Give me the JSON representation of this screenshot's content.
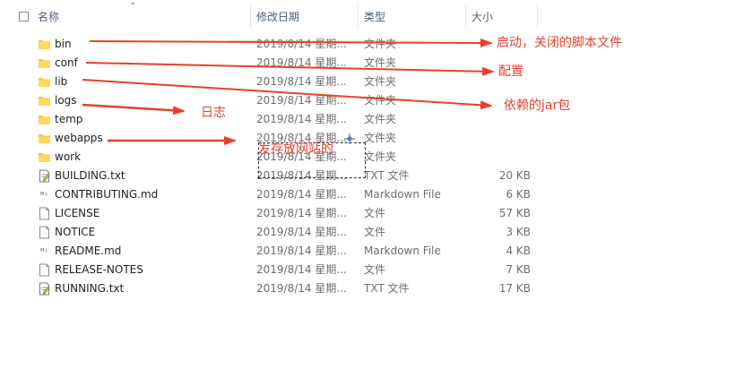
{
  "header": {
    "name": "名称",
    "date": "修改日期",
    "type": "类型",
    "size": "大小"
  },
  "files": [
    {
      "name": "bin",
      "date": "2019/8/14 星期...",
      "type": "文件夹",
      "size": "",
      "icon": "folder-icon"
    },
    {
      "name": "conf",
      "date": "2019/8/14 星期...",
      "type": "文件夹",
      "size": "",
      "icon": "folder-icon"
    },
    {
      "name": "lib",
      "date": "2019/8/14 星期...",
      "type": "文件夹",
      "size": "",
      "icon": "folder-icon"
    },
    {
      "name": "logs",
      "date": "2019/8/14 星期...",
      "type": "文件夹",
      "size": "",
      "icon": "folder-icon"
    },
    {
      "name": "temp",
      "date": "2019/8/14 星期...",
      "type": "文件夹",
      "size": "",
      "icon": "folder-icon"
    },
    {
      "name": "webapps",
      "date": "2019/8/14 星期...",
      "type": "文件夹",
      "size": "",
      "icon": "folder-icon"
    },
    {
      "name": "work",
      "date": "2019/8/14 星期...",
      "type": "文件夹",
      "size": "",
      "icon": "folder-icon"
    },
    {
      "name": "BUILDING.txt",
      "date": "2019/8/14 星期...",
      "type": "TXT 文件",
      "size": "20 KB",
      "icon": "text-file-icon"
    },
    {
      "name": "CONTRIBUTING.md",
      "date": "2019/8/14 星期...",
      "type": "Markdown File",
      "size": "6 KB",
      "icon": "markdown-file-icon"
    },
    {
      "name": "LICENSE",
      "date": "2019/8/14 星期...",
      "type": "文件",
      "size": "57 KB",
      "icon": "blank-file-icon"
    },
    {
      "name": "NOTICE",
      "date": "2019/8/14 星期...",
      "type": "文件",
      "size": "3 KB",
      "icon": "blank-file-icon"
    },
    {
      "name": "README.md",
      "date": "2019/8/14 星期...",
      "type": "Markdown File",
      "size": "4 KB",
      "icon": "markdown-file-icon"
    },
    {
      "name": "RELEASE-NOTES",
      "date": "2019/8/14 星期...",
      "type": "文件",
      "size": "7 KB",
      "icon": "blank-file-icon"
    },
    {
      "name": "RUNNING.txt",
      "date": "2019/8/14 星期...",
      "type": "TXT 文件",
      "size": "17 KB",
      "icon": "text-file-icon"
    }
  ],
  "annotations": {
    "bin": "启动，关闭的脚本文件",
    "conf": "配置",
    "lib_prefix": "依赖的",
    "lib_code": "jar",
    "lib_suffix": "包",
    "logs": "日志",
    "webapps": "发存放网站的"
  },
  "colors": {
    "annotation": "#e8402a",
    "folder": "#f5c94a",
    "header_text": "#4c607a"
  }
}
